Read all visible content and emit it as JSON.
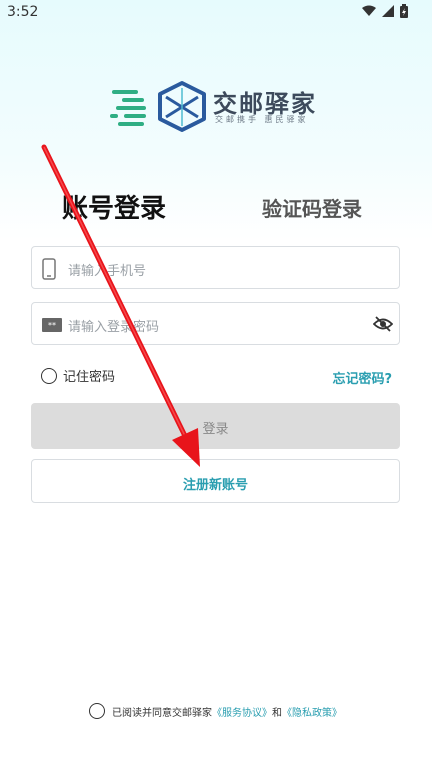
{
  "status_bar": {
    "time": "3:52",
    "icons": [
      "wifi-icon",
      "signal-icon",
      "battery-charging-icon"
    ]
  },
  "logo": {
    "title": "交邮驿家",
    "subtitle": "交邮携手  惠民驿家"
  },
  "tabs": {
    "account_login": "账号登录",
    "sms_login": "验证码登录"
  },
  "phone_input": {
    "placeholder": "请输入手机号",
    "value": ""
  },
  "password_input": {
    "placeholder": "请输入登录密码",
    "value": ""
  },
  "remember_label": "记住密码",
  "forgot_label": "忘记密码?",
  "login_button": "登录",
  "register_button": "注册新账号",
  "agreement": {
    "prefix": "已阅读并同意交邮驿家",
    "service": "《服务协议》",
    "and": "和",
    "privacy": "《隐私政策》"
  },
  "colors": {
    "accent": "#2a9eb0",
    "annotation_arrow": "#e8141b"
  }
}
